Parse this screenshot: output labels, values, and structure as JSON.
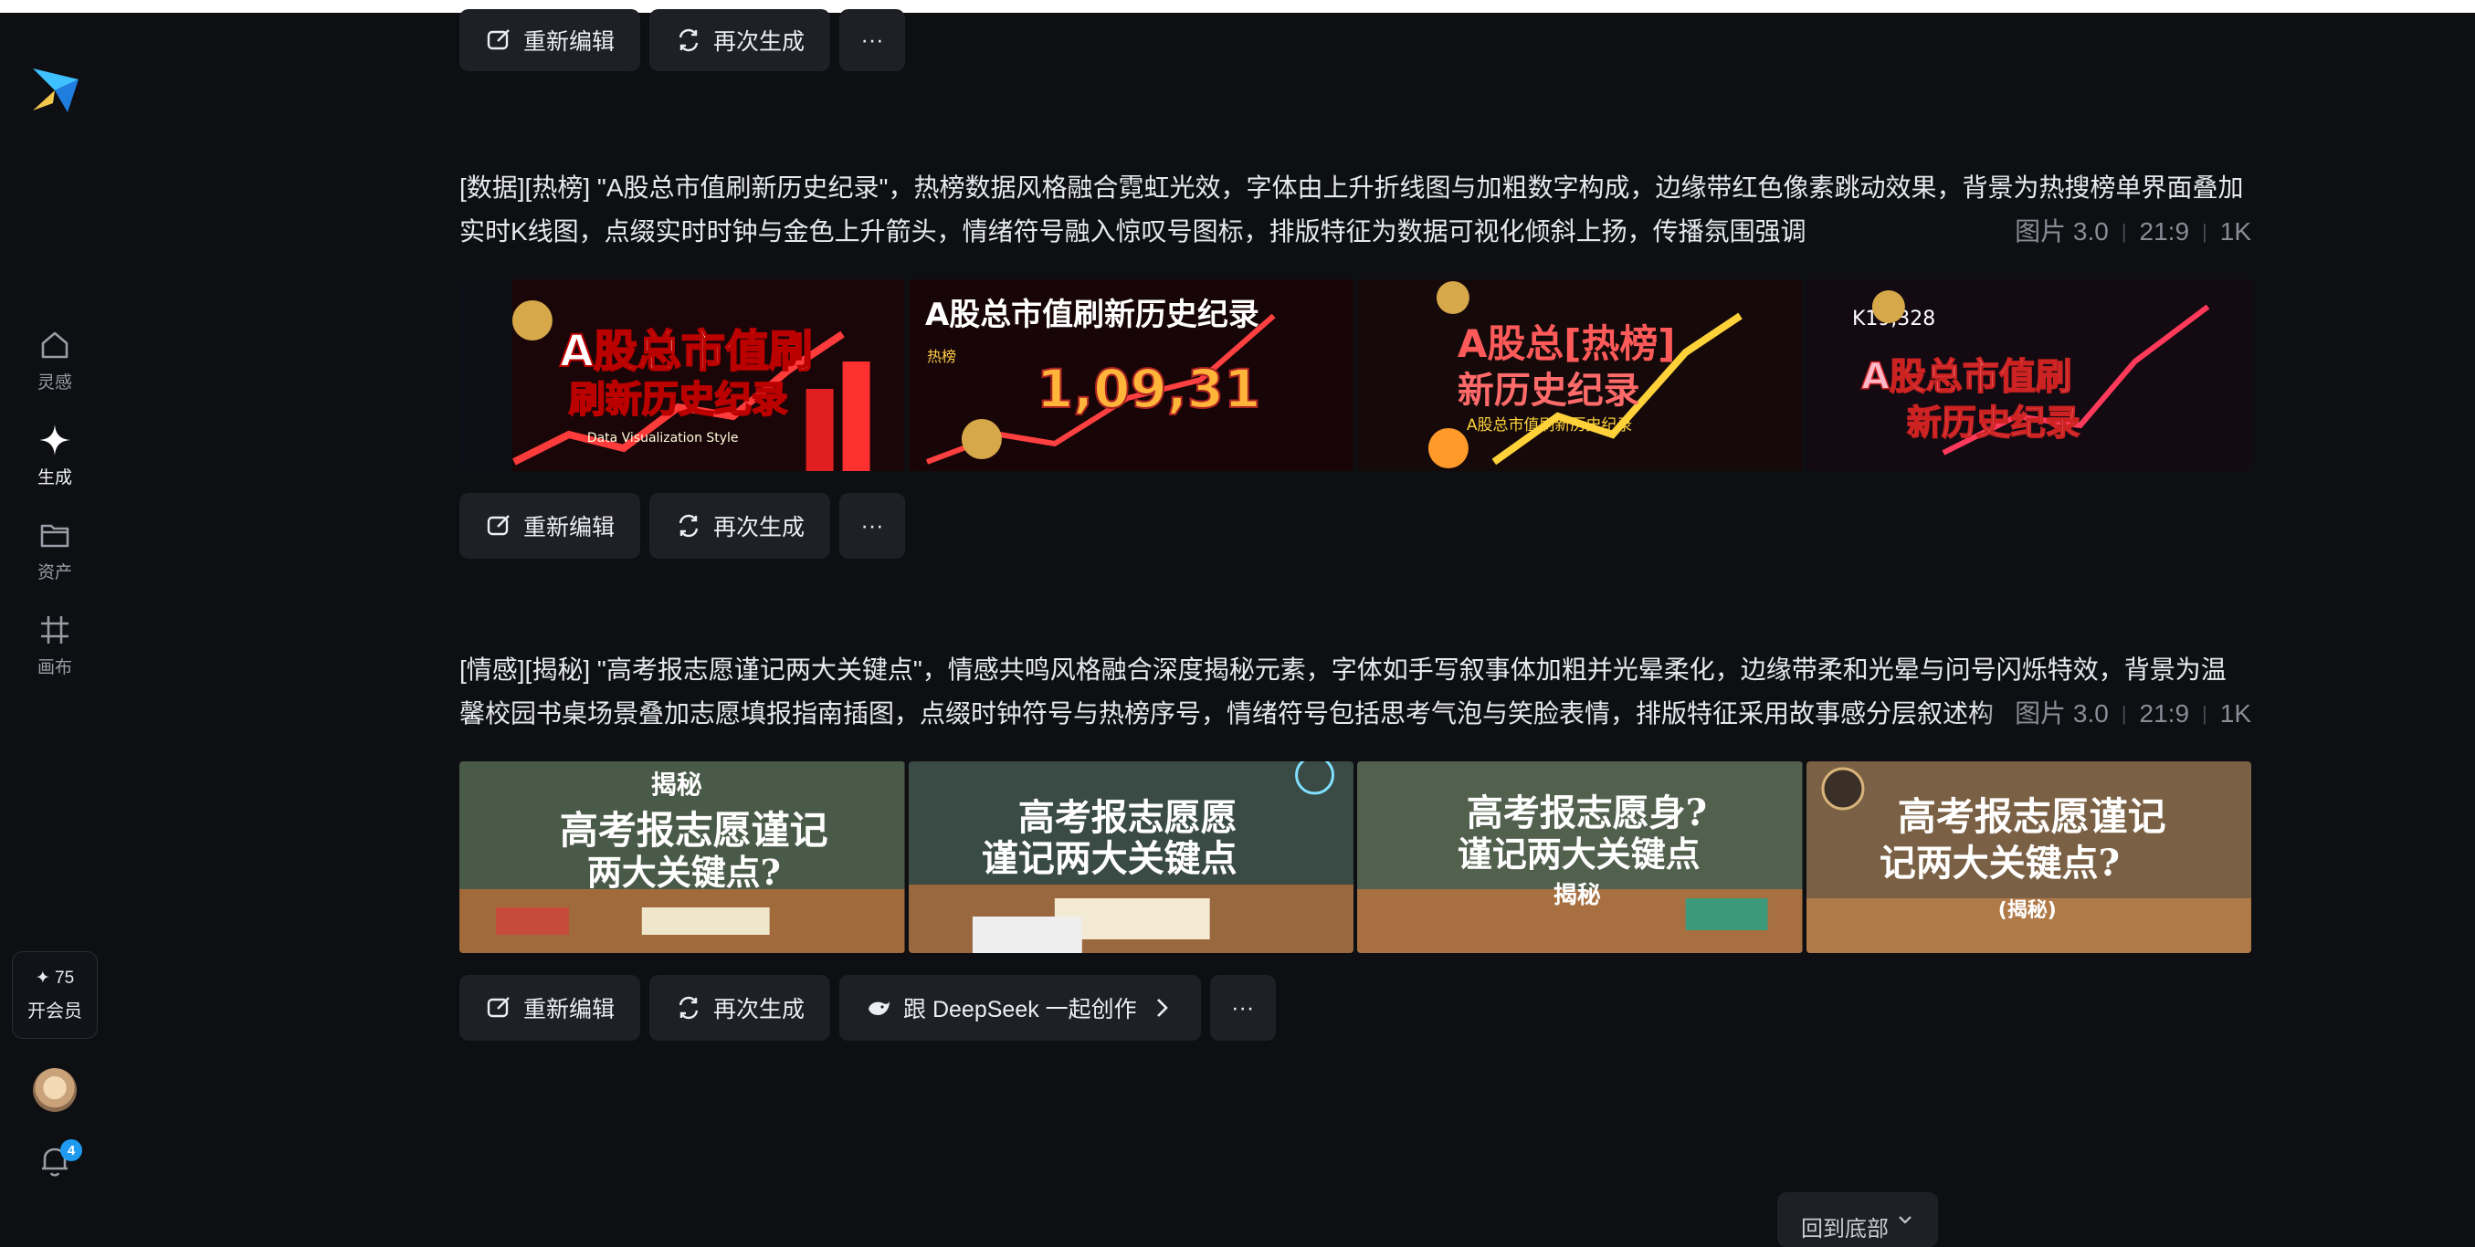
{
  "sidebar": {
    "nav": [
      {
        "label": "灵感",
        "icon": "home-icon"
      },
      {
        "label": "生成",
        "icon": "sparkle-icon"
      },
      {
        "label": "资产",
        "icon": "folder-icon"
      },
      {
        "label": "画布",
        "icon": "canvas-icon"
      }
    ],
    "vip": {
      "credits": "✦ 75",
      "label": "开会员"
    },
    "notification_count": "4"
  },
  "actions": {
    "re_edit": "重新编辑",
    "regenerate": "再次生成",
    "deepseek": "跟 DeepSeek 一起创作",
    "more": "···"
  },
  "generations": [
    {
      "prompt": "[数据][热榜] \"A股总市值刷新历史纪录\"，热榜数据风格融合霓虹光效，字体由上升折线图与加粗数字构成，边缘带红色像素跳动效果，背景为热搜榜单界面叠加实时K线图，点缀实时时钟与金色上升箭头，情绪符号融入惊叹号图标，排版特征为数据可视化倾斜上扬，传播氛围强调",
      "meta": {
        "type": "图片 3.0",
        "ratio": "21:9",
        "res": "1K"
      },
      "thumbs": [
        "A股总市值刷新历史纪录",
        "A股总市值刷新历史纪录 1,09,31",
        "A股总[热榜] 新历史纪录",
        "A股总市值刷新历史纪录 K19,328"
      ]
    },
    {
      "prompt": "[情感][揭秘] \"高考报志愿谨记两大关键点\"，情感共鸣风格融合深度揭秘元素，字体如手写叙事体加粗并光晕柔化，边缘带柔和光晕与问号闪烁特效，背景为温馨校园书桌场景叠加志愿填报指南插图，点缀时钟符号与热榜序号，情绪符号包括思考气泡与笑脸表情，排版特征采用故事感分层叙述构",
      "meta": {
        "type": "图片 3.0",
        "ratio": "21:9",
        "res": "1K"
      },
      "thumbs": [
        "揭秘 高考报志愿谨记两大关键点?",
        "高考报志愿 谨记两大关键点",
        "高考报志愿身? 谨记两大关键点 揭秘",
        "高考报志愿谨记两大关键点? (揭秘)"
      ]
    }
  ],
  "thumb_text": {
    "a1": "A股总市值刷",
    "a2": "刷新历史纪录",
    "a3": "Data Visualization Style",
    "b1": "A股总市值刷新历史纪录",
    "b2": "1,09,31",
    "b3": "热榜",
    "c1": "A股总[热榜]",
    "c2": "新历史纪录",
    "c3": "A股总市值刷新历史纪录",
    "d1": "A股总市值刷",
    "d2": "新历史纪录",
    "d3": "K19,328",
    "e0": "揭秘",
    "e1": "高考报志愿谨记",
    "e2": "两大关键点?",
    "f1": "高考报志愿愿",
    "f2": "谨记两大关键点",
    "g1": "高考报志愿身?",
    "g2": "谨记两大关键点",
    "g3": "揭秘",
    "h1": "高考报志愿谨记",
    "h2": "记两大关键点?",
    "h3": "(揭秘)"
  },
  "scroll_bottom": "回到底部",
  "colors": {
    "bg": "#0e0f13",
    "button": "#1f2026",
    "accent": "#1e9bf0"
  }
}
